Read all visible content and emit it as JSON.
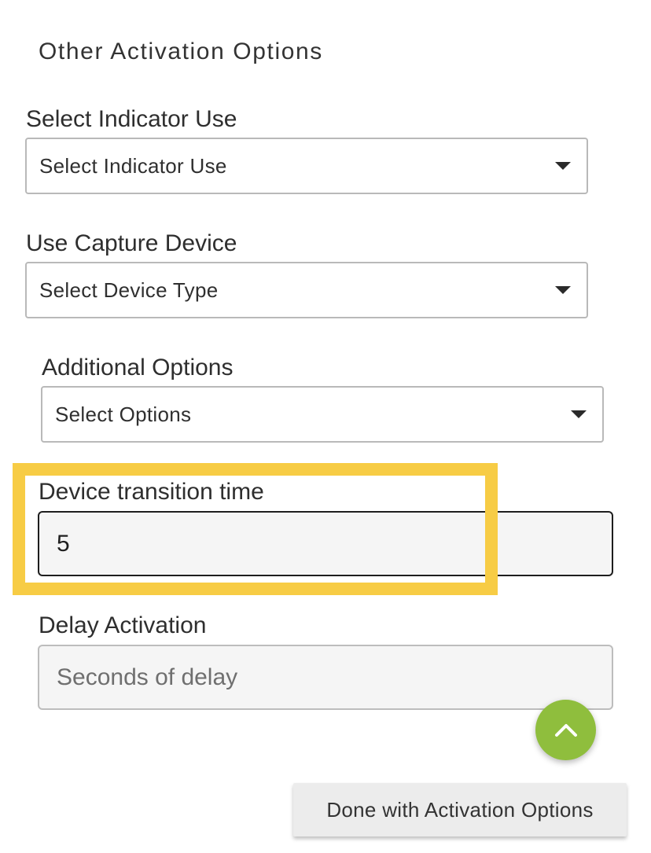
{
  "section": {
    "title": "Other Activation Options"
  },
  "indicator": {
    "label": "Select Indicator Use",
    "selected": "Select Indicator Use"
  },
  "capture_device": {
    "label": "Use Capture Device",
    "selected": "Select Device Type"
  },
  "additional_options": {
    "label": "Additional Options",
    "selected": "Select Options"
  },
  "transition_time": {
    "label": "Device transition time",
    "value": "5"
  },
  "delay": {
    "label": "Delay Activation",
    "placeholder": "Seconds of delay",
    "value": ""
  },
  "fab": {
    "icon": "chevron-up-icon",
    "color": "#8fbe3d"
  },
  "done_button": {
    "label": "Done with Activation Options"
  },
  "highlight": {
    "color": "#f7cc45"
  }
}
